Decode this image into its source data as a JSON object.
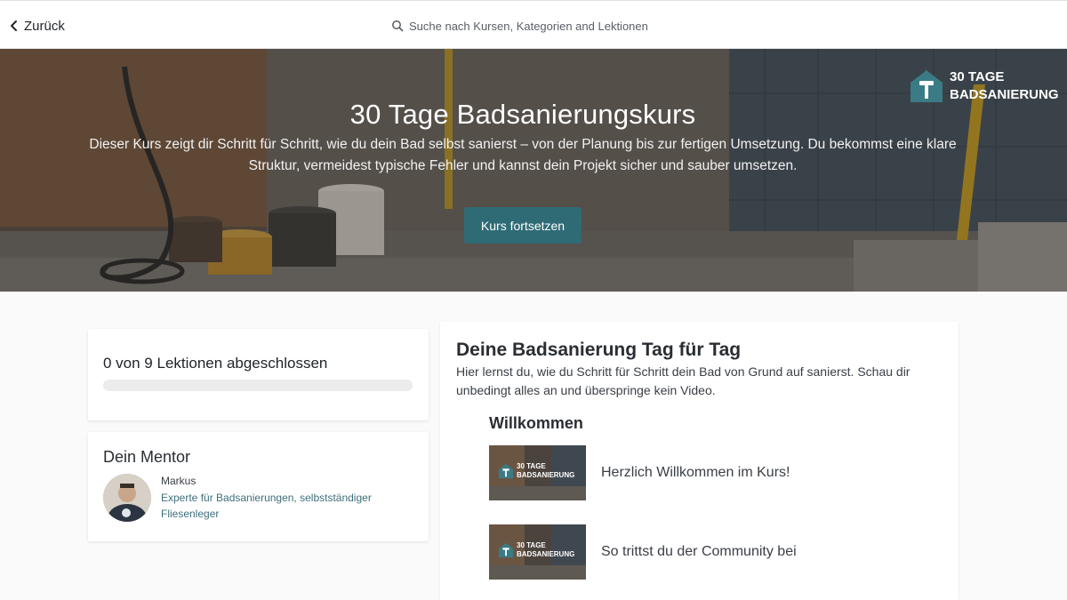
{
  "topbar": {
    "back_label": "Zurück",
    "search_placeholder": "Suche nach Kursen, Kategorien and Lektionen"
  },
  "hero": {
    "title": "30 Tage Badsanierungskurs",
    "description": "Dieser Kurs zeigt dir Schritt für Schritt, wie du dein Bad selbst sanierst – von der Planung bis zur fertigen Umsetzung. Du bekommst eine klare Struktur, vermeidest typische Fehler und kannst dein Projekt sicher und sauber umsetzen.",
    "cta_label": "Kurs fortsetzen",
    "brand_line1": "30 TAGE",
    "brand_line2": "BADSANIERUNG"
  },
  "progress": {
    "label": "0 von 9 Lektionen abgeschlossen",
    "completed": 0,
    "total": 9
  },
  "mentor": {
    "heading": "Dein Mentor",
    "name": "Markus",
    "role": "Experte für Badsanierungen, selbstständiger Fliesenleger"
  },
  "course": {
    "section_title": "Deine Badsanierung Tag für Tag",
    "section_desc": "Hier lernst du, wie du Schritt für Schritt dein Bad von Grund auf sanierst. Schau dir unbedingt alles an und überspringe kein Video.",
    "module_title": "Willkommen",
    "lessons": [
      {
        "title": "Herzlich Willkommen im Kurs!",
        "thumb_line1": "30 TAGE",
        "thumb_line2": "BADSANIERUNG"
      },
      {
        "title": "So trittst du der Community bei",
        "thumb_line1": "30 TAGE",
        "thumb_line2": "BADSANIERUNG"
      }
    ]
  },
  "colors": {
    "accent": "#2e6b75",
    "link": "#3d6f7a",
    "progress_track": "#ececec"
  },
  "icons": {
    "back": "chevron-left-icon",
    "search": "search-icon",
    "brand": "house-hammer-icon"
  }
}
